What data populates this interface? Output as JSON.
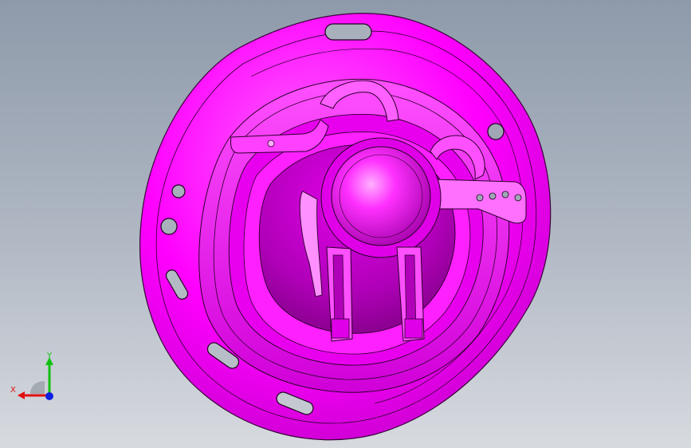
{
  "viewport": {
    "background_top": "#8e9aaa",
    "background_bottom": "#d7dadf"
  },
  "model": {
    "part_color": "#ff00ff",
    "shadow_color": "#a000a8",
    "highlight_color": "#ff9cff",
    "edge_color": "#2a002a"
  },
  "triad": {
    "x_label": "X",
    "y_label": "Y",
    "x_color": "#e01010",
    "y_color": "#10c010",
    "z_color": "#1020e0"
  }
}
